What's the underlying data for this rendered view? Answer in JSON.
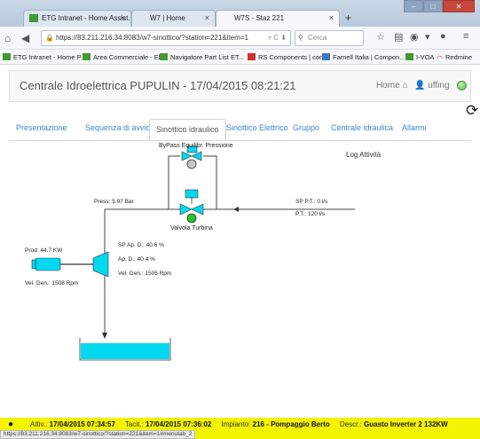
{
  "browser": {
    "tabs": [
      {
        "label": "ETG Intranet - Home Assist..."
      },
      {
        "label": "W7 | Home"
      },
      {
        "label": "W7S - Staz 221"
      }
    ],
    "url": "https://83.211.216.34:8083/w7-sinottico/?station=221&item=1",
    "search_placeholder": "Cerca",
    "bookmarks": [
      "ETG Intranet - Home P...",
      "Area Commerciale - El...",
      "Navigatore Part List ET...",
      "RS Components | com...",
      "Farnell Italia | Compon...",
      "I-VOA",
      "Redmine"
    ],
    "status_url": "https://83.211.216.34:8083/w7-sinottico/?station=221&item=1#menutab_2"
  },
  "header": {
    "title": "Centrale Idroelettrica PUPULIN - 17/04/2015 08:21:21",
    "home_label": "Home",
    "user_label": "uffing"
  },
  "tabs": [
    {
      "label": "Presentazione"
    },
    {
      "label": "Sequenza di avvio"
    },
    {
      "label": "Sinottico idraulico"
    },
    {
      "label": "Sinottico Elettrico"
    },
    {
      "label": "Gruppo"
    },
    {
      "label": "Centrale idraulica"
    },
    {
      "label": "Allarmi"
    }
  ],
  "active_tab": "Sinottico idraulico",
  "diagram": {
    "bypass_label": "ByPass Equilibr. Pressione",
    "log_title": "Log Attività",
    "press_label": "Press: 5.97 Bar",
    "sp_pt_label": "SP P.T.: 0 l/s",
    "pt_label": "P.T.: 120 l/s",
    "valve_label": "Valvola Turbina",
    "prod_label": "Prod: 44.7 KW",
    "vel_gen_left_label": "Vel. Gen.: 1508 Rpm",
    "sp_ap_label": "SP Ap. D.: 40.6 %",
    "ap_label": "Ap. D.: 40.4 %",
    "vel_gen_right_label": "Vel. Gen.: 1505 Rpm"
  },
  "status": {
    "attiv_label": "Attiv.:",
    "attiv_value": "17/04/2015 07:34:57",
    "tacit_label": "Tacit.:",
    "tacit_value": "17/04/2015 07:36:02",
    "impianto_label": "Impianto:",
    "impianto_value": "216 - Pompaggio Berto",
    "descr_label": "Descr.:",
    "descr_value": "Guasto Inverter 2 132KW"
  },
  "colors": {
    "accent": "#3a87c8",
    "equipment": "#00d8f0",
    "status_bar": "#f4f400",
    "ok_indicator": "#21c729"
  }
}
